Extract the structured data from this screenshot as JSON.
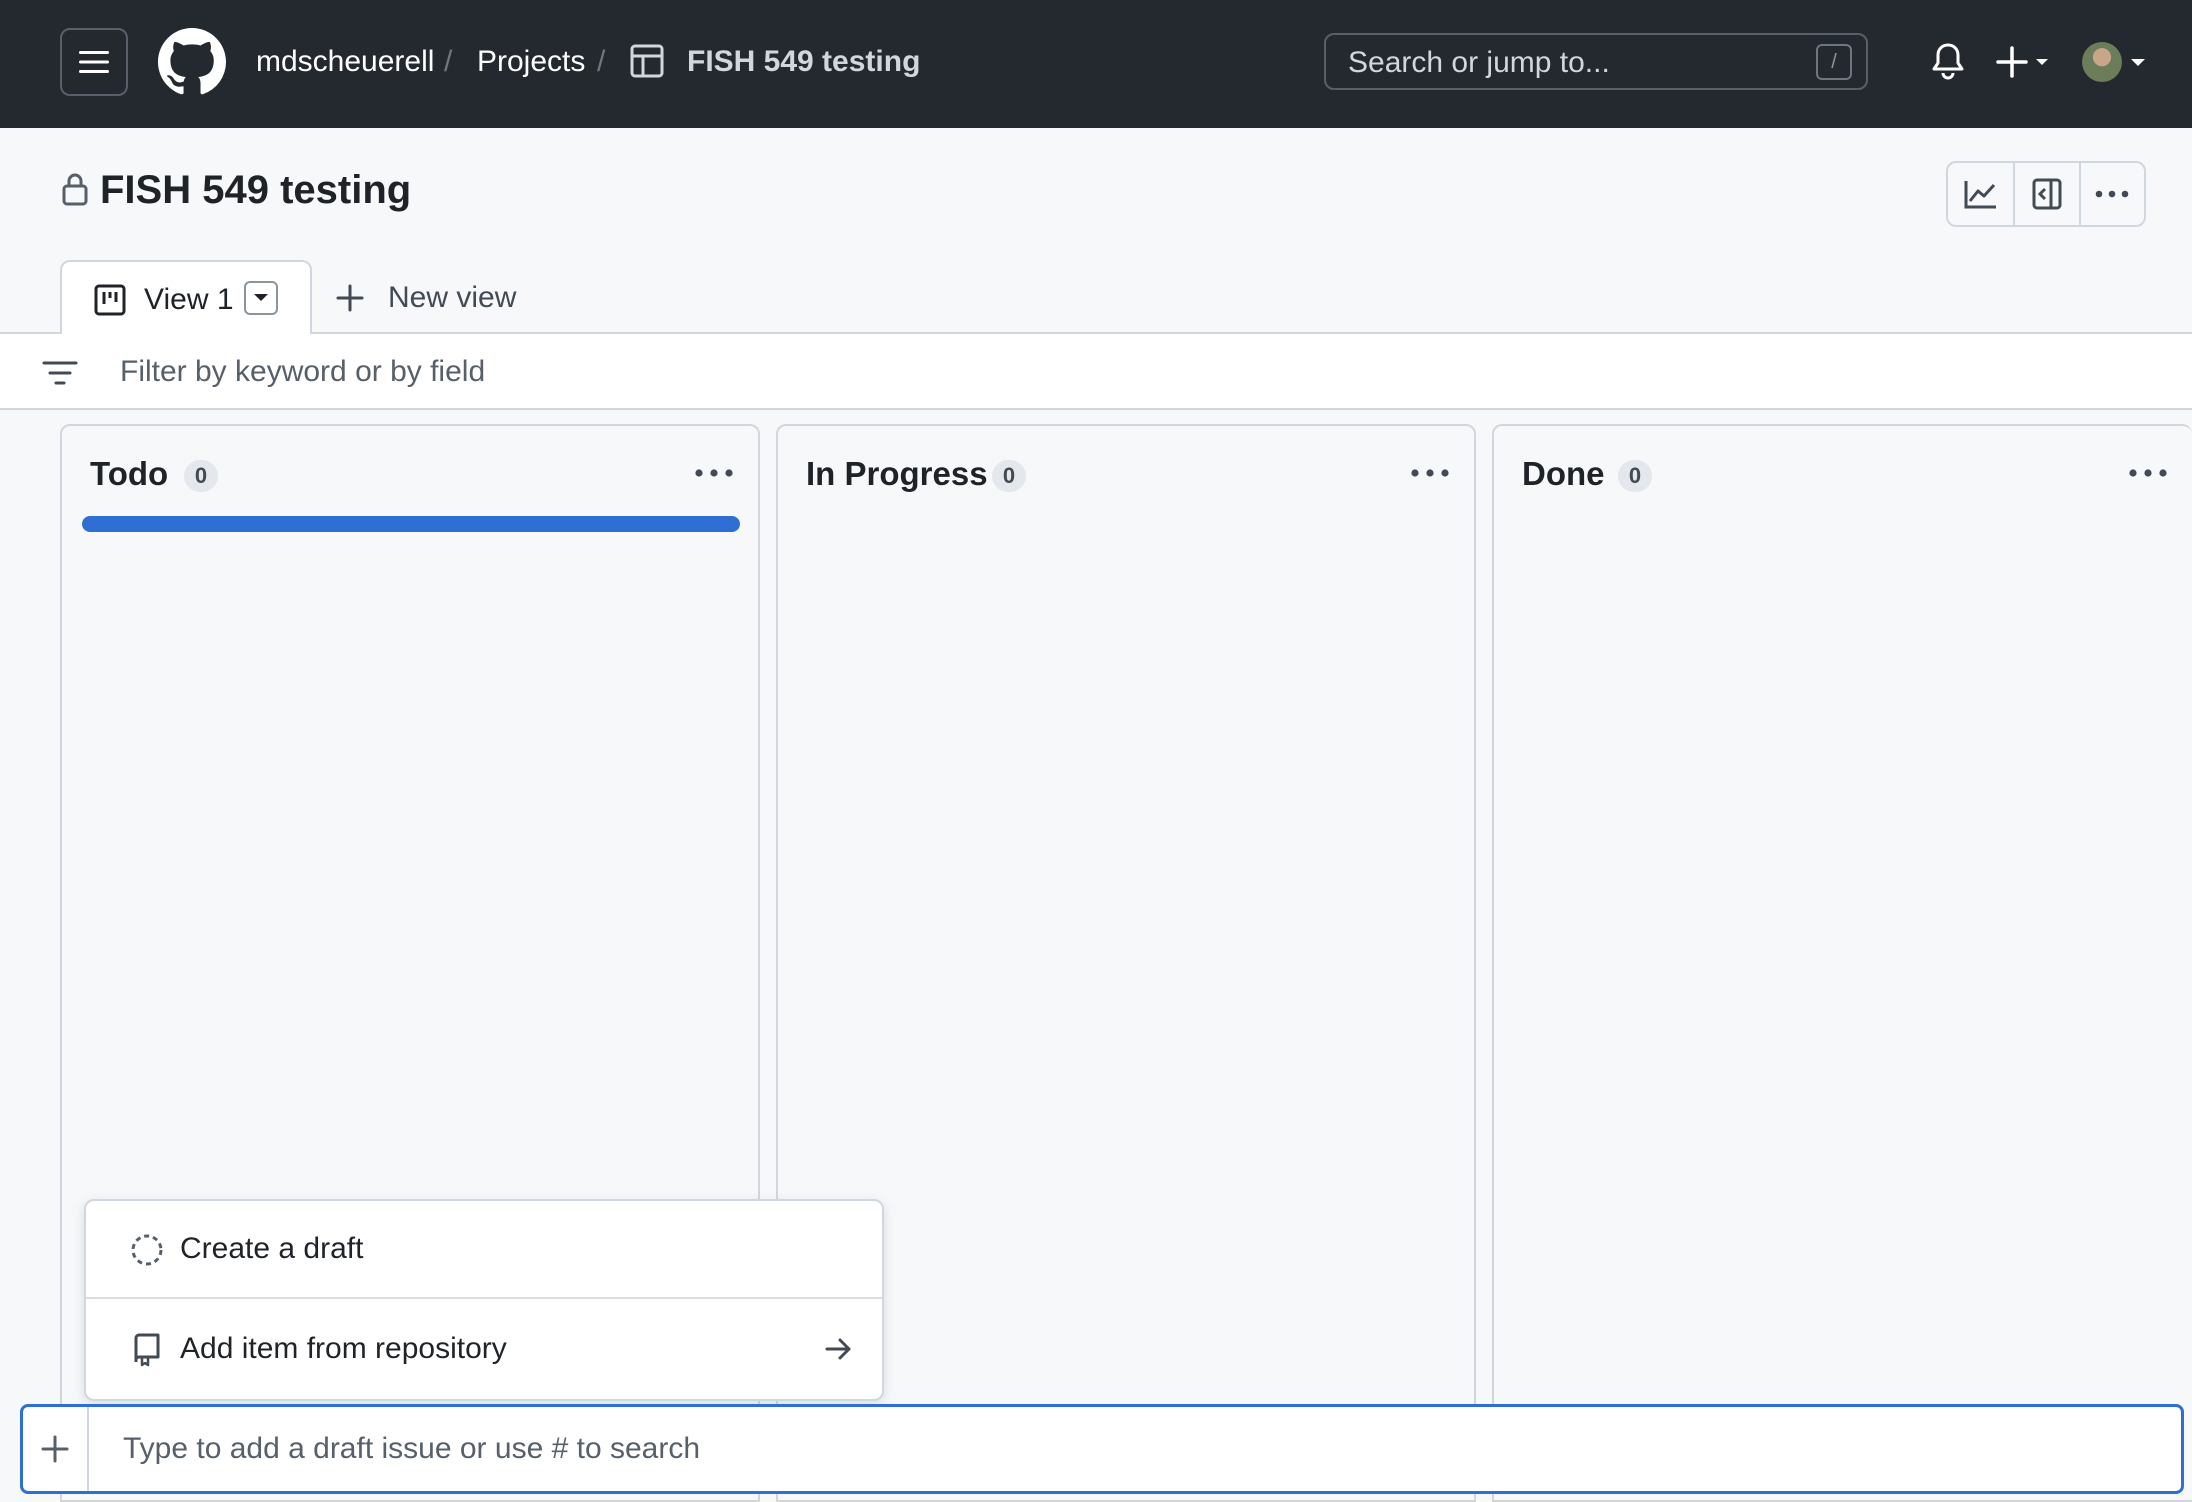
{
  "header": {
    "owner": "mdscheuerell",
    "sep": "/",
    "projects": "Projects",
    "project_name": "FISH 549 testing",
    "search_placeholder": "Search or jump to...",
    "search_shortcut": "/"
  },
  "project": {
    "title": "FISH 549 testing"
  },
  "tabs": [
    {
      "label": "View 1"
    }
  ],
  "new_view_label": "New view",
  "filter": {
    "placeholder": "Filter by keyword or by field"
  },
  "columns": [
    {
      "title": "Todo",
      "count": "0"
    },
    {
      "title": "In Progress",
      "count": "0"
    },
    {
      "title": "Done",
      "count": "0"
    }
  ],
  "popup": {
    "create_draft": "Create a draft",
    "add_from_repo": "Add item from repository"
  },
  "draft_input": {
    "placeholder": "Type to add a draft issue or use # to search"
  },
  "colors": {
    "header_bg": "#24292f",
    "accent": "#2f6fd4",
    "page_bg": "#f6f8fa"
  }
}
